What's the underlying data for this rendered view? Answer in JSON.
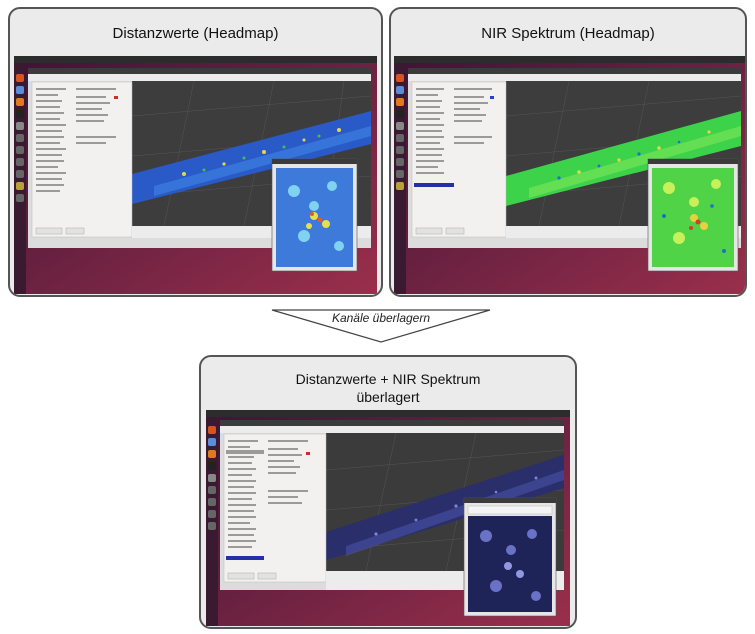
{
  "panels": {
    "distance": {
      "title": "Distanzwerte (Headmap)"
    },
    "nir": {
      "title": "NIR Spektrum (Headmap)"
    },
    "combined": {
      "title_line1": "Distanzwerte + NIR Spektrum",
      "title_line2": "überlagert"
    }
  },
  "arrow": {
    "label": "Kanäle überlagern"
  },
  "colors": {
    "desktop_bg": "#4a1a3a",
    "desktop_bg2": "#8a2c4a",
    "launcher": "#3a1a30",
    "topbar": "#2c2c2c",
    "viewport": "#3c3c3c",
    "sidebar": "#f2f1f0",
    "distance_blue": "#2a5ac8",
    "nir_green": "#3cd24a",
    "combined_navy": "#2a2e6a"
  },
  "icons": [
    "ubuntu-launcher-icon",
    "files-icon",
    "browser-icon",
    "terminal-icon",
    "settings-icon"
  ]
}
